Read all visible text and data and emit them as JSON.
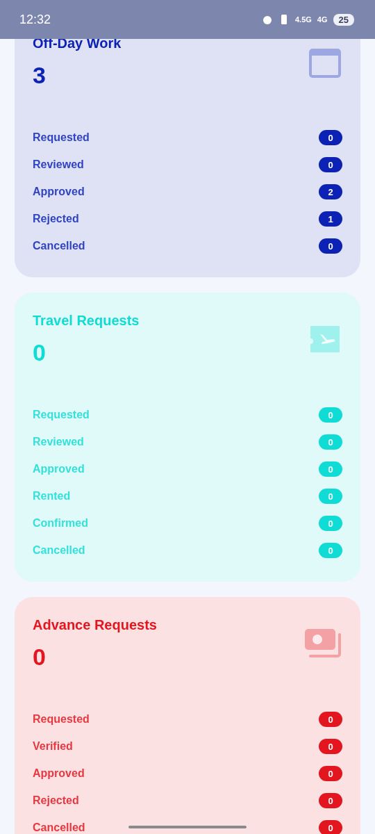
{
  "status_bar": {
    "time": "12:32",
    "network_1": "4.5G",
    "network_2": "4G",
    "battery": "25"
  },
  "cards": [
    {
      "kind": "calendar",
      "title": "Off-Day Work",
      "total": "3",
      "color": "#0b22b5",
      "rows": [
        {
          "label": "Requested",
          "count": "0"
        },
        {
          "label": "Reviewed",
          "count": "0"
        },
        {
          "label": "Approved",
          "count": "2"
        },
        {
          "label": "Rejected",
          "count": "1"
        },
        {
          "label": "Cancelled",
          "count": "0"
        }
      ]
    },
    {
      "kind": "travel",
      "title": "Travel Requests",
      "total": "0",
      "color": "#0fdcd4",
      "rows": [
        {
          "label": "Requested",
          "count": "0"
        },
        {
          "label": "Reviewed",
          "count": "0"
        },
        {
          "label": "Approved",
          "count": "0"
        },
        {
          "label": "Rented",
          "count": "0"
        },
        {
          "label": "Confirmed",
          "count": "0"
        },
        {
          "label": "Cancelled",
          "count": "0"
        }
      ]
    },
    {
      "kind": "money",
      "title": "Advance Requests",
      "total": "0",
      "color": "#e3151f",
      "rows": [
        {
          "label": "Requested",
          "count": "0"
        },
        {
          "label": "Verified",
          "count": "0"
        },
        {
          "label": "Approved",
          "count": "0"
        },
        {
          "label": "Rejected",
          "count": "0"
        },
        {
          "label": "Cancelled",
          "count": "0"
        }
      ]
    }
  ]
}
